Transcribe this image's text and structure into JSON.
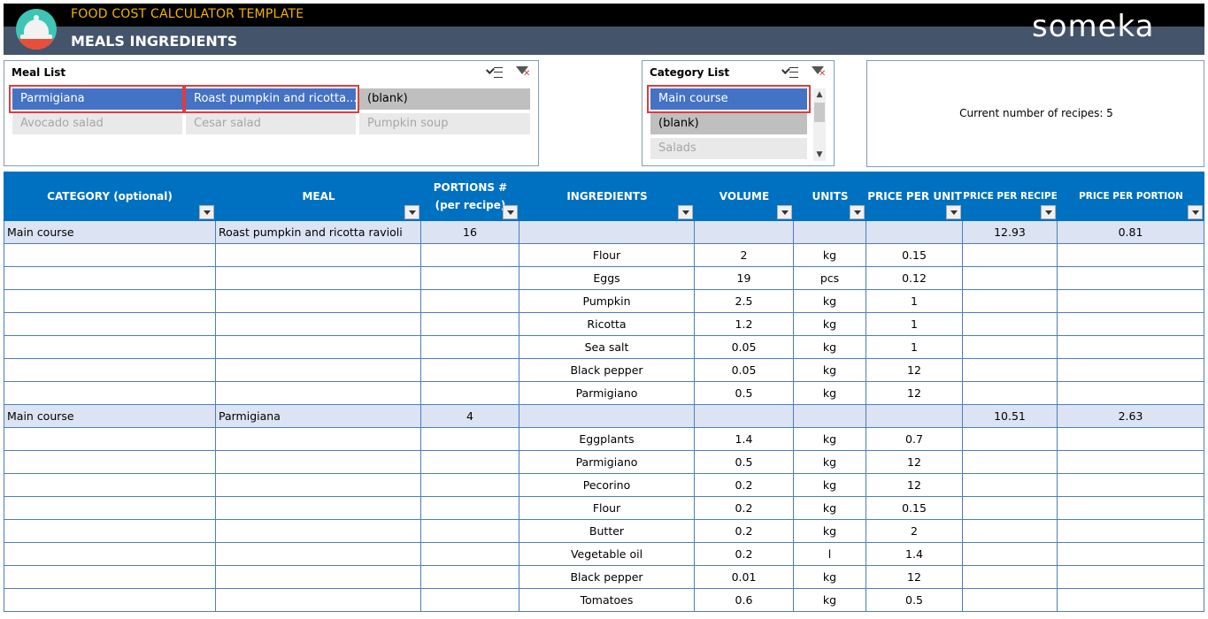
{
  "header": {
    "app_title": "FOOD COST CALCULATOR TEMPLATE",
    "page_title": "MEALS INGREDIENTS",
    "brand": "someka",
    "logo_icon": "food-cloche-icon",
    "colors": {
      "app_title": "#f4b400",
      "band_top": "#000000",
      "band_bottom": "#44546a"
    }
  },
  "meal_slicer": {
    "title": "Meal List",
    "multi_select_icon": "multi-select-icon",
    "clear_filter_icon": "clear-filter-icon",
    "items": [
      {
        "label": "Parmigiana",
        "state": "selected"
      },
      {
        "label": "Roast pumpkin and ricotta...",
        "state": "selected"
      },
      {
        "label": "(blank)",
        "state": "available"
      },
      {
        "label": "Avocado salad",
        "state": "no-data"
      },
      {
        "label": "Cesar salad",
        "state": "no-data"
      },
      {
        "label": "Pumpkin soup",
        "state": "no-data"
      }
    ]
  },
  "category_slicer": {
    "title": "Category List",
    "multi_select_icon": "multi-select-icon",
    "clear_filter_icon": "clear-filter-icon",
    "items": [
      {
        "label": "Main course",
        "state": "selected"
      },
      {
        "label": "(blank)",
        "state": "available"
      },
      {
        "label": "Salads",
        "state": "no-data"
      }
    ]
  },
  "info": {
    "recipes_text": "Current number of recipes: 5"
  },
  "table": {
    "header_color": "#0070c0",
    "columns": [
      "CATEGORY (optional)",
      "MEAL",
      "PORTIONS #\n(per recipe)",
      "INGREDIENTS",
      "VOLUME",
      "UNITS",
      "PRICE PER UNIT",
      "PRICE PER RECIPE",
      "PRICE PER PORTION"
    ],
    "rows": [
      {
        "group": true,
        "category": "Main course",
        "meal": "Roast pumpkin and ricotta ravioli",
        "portions": "16",
        "ingredient": "",
        "volume": "",
        "units": "",
        "price_unit": "",
        "price_recipe": "12.93",
        "price_portion": "0.81"
      },
      {
        "group": false,
        "category": "",
        "meal": "",
        "portions": "",
        "ingredient": "Flour",
        "volume": "2",
        "units": "kg",
        "price_unit": "0.15",
        "price_recipe": "",
        "price_portion": ""
      },
      {
        "group": false,
        "category": "",
        "meal": "",
        "portions": "",
        "ingredient": "Eggs",
        "volume": "19",
        "units": "pcs",
        "price_unit": "0.12",
        "price_recipe": "",
        "price_portion": ""
      },
      {
        "group": false,
        "category": "",
        "meal": "",
        "portions": "",
        "ingredient": "Pumpkin",
        "volume": "2.5",
        "units": "kg",
        "price_unit": "1",
        "price_recipe": "",
        "price_portion": ""
      },
      {
        "group": false,
        "category": "",
        "meal": "",
        "portions": "",
        "ingredient": "Ricotta",
        "volume": "1.2",
        "units": "kg",
        "price_unit": "1",
        "price_recipe": "",
        "price_portion": ""
      },
      {
        "group": false,
        "category": "",
        "meal": "",
        "portions": "",
        "ingredient": "Sea salt",
        "volume": "0.05",
        "units": "kg",
        "price_unit": "1",
        "price_recipe": "",
        "price_portion": ""
      },
      {
        "group": false,
        "category": "",
        "meal": "",
        "portions": "",
        "ingredient": "Black pepper",
        "volume": "0.05",
        "units": "kg",
        "price_unit": "12",
        "price_recipe": "",
        "price_portion": ""
      },
      {
        "group": false,
        "category": "",
        "meal": "",
        "portions": "",
        "ingredient": "Parmigiano",
        "volume": "0.5",
        "units": "kg",
        "price_unit": "12",
        "price_recipe": "",
        "price_portion": ""
      },
      {
        "group": true,
        "category": "Main course",
        "meal": "Parmigiana",
        "portions": "4",
        "ingredient": "",
        "volume": "",
        "units": "",
        "price_unit": "",
        "price_recipe": "10.51",
        "price_portion": "2.63"
      },
      {
        "group": false,
        "category": "",
        "meal": "",
        "portions": "",
        "ingredient": "Eggplants",
        "volume": "1.4",
        "units": "kg",
        "price_unit": "0.7",
        "price_recipe": "",
        "price_portion": ""
      },
      {
        "group": false,
        "category": "",
        "meal": "",
        "portions": "",
        "ingredient": "Parmigiano",
        "volume": "0.5",
        "units": "kg",
        "price_unit": "12",
        "price_recipe": "",
        "price_portion": ""
      },
      {
        "group": false,
        "category": "",
        "meal": "",
        "portions": "",
        "ingredient": "Pecorino",
        "volume": "0.2",
        "units": "kg",
        "price_unit": "12",
        "price_recipe": "",
        "price_portion": ""
      },
      {
        "group": false,
        "category": "",
        "meal": "",
        "portions": "",
        "ingredient": "Flour",
        "volume": "0.2",
        "units": "kg",
        "price_unit": "0.15",
        "price_recipe": "",
        "price_portion": ""
      },
      {
        "group": false,
        "category": "",
        "meal": "",
        "portions": "",
        "ingredient": "Butter",
        "volume": "0.2",
        "units": "kg",
        "price_unit": "2",
        "price_recipe": "",
        "price_portion": ""
      },
      {
        "group": false,
        "category": "",
        "meal": "",
        "portions": "",
        "ingredient": "Vegetable oil",
        "volume": "0.2",
        "units": "l",
        "price_unit": "1.4",
        "price_recipe": "",
        "price_portion": ""
      },
      {
        "group": false,
        "category": "",
        "meal": "",
        "portions": "",
        "ingredient": "Black pepper",
        "volume": "0.01",
        "units": "kg",
        "price_unit": "12",
        "price_recipe": "",
        "price_portion": ""
      },
      {
        "group": false,
        "category": "",
        "meal": "",
        "portions": "",
        "ingredient": "Tomatoes",
        "volume": "0.6",
        "units": "kg",
        "price_unit": "0.5",
        "price_recipe": "",
        "price_portion": ""
      }
    ]
  }
}
